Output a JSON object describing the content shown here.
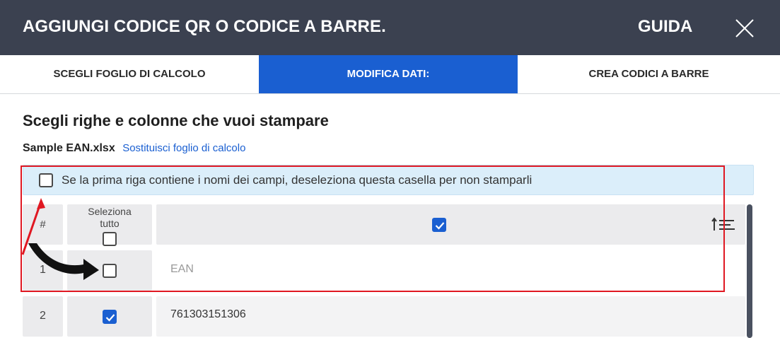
{
  "dialog": {
    "title": "AGGIUNGI CODICE QR O CODICE A BARRE.",
    "help_label": "GUIDA",
    "close_icon": "close-icon"
  },
  "steps": [
    {
      "label": "SCEGLI FOGLIO DI CALCOLO",
      "active": false
    },
    {
      "label": "MODIFICA DATI:",
      "active": true
    },
    {
      "label": "CREA CODICI A BARRE",
      "active": false
    }
  ],
  "main": {
    "heading": "Scegli righe e colonne che vuoi stampare",
    "file_name": "Sample EAN.xlsx",
    "replace_link": "Sostituisci foglio di calcolo",
    "header_notice": "Se la prima riga contiene i nomi dei campi, deseleziona questa casella per non stamparli",
    "header_notice_checked": false
  },
  "table": {
    "num_header": "#",
    "select_all_label": "Seleziona tutto",
    "select_all_line1": "Seleziona",
    "select_all_line2": "tutto",
    "select_all_checked": false,
    "column_checked": true,
    "sort_icon": "sort-icon",
    "rows": [
      {
        "num": "1",
        "checked": false,
        "value": "EAN"
      },
      {
        "num": "2",
        "checked": true,
        "value": "761303151306"
      }
    ]
  },
  "colors": {
    "titlebar": "#3b4150",
    "accent": "#1a5fd1",
    "notice_bg": "#dbeefa",
    "annotation_red": "#e01822"
  }
}
